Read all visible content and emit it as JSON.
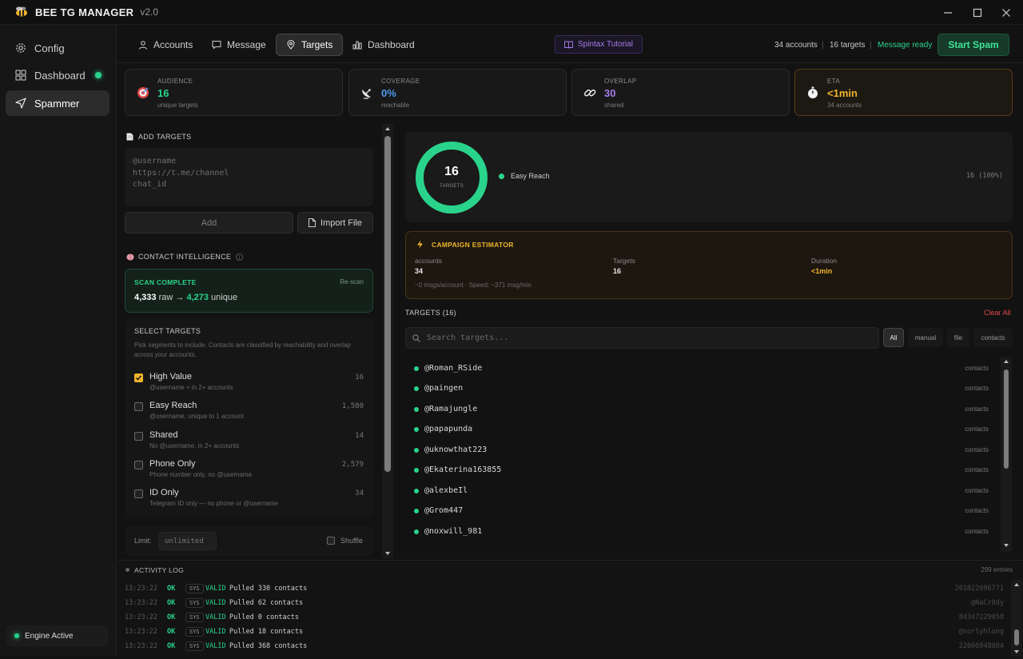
{
  "app": {
    "title": "BEE TG MANAGER",
    "version": "v2.0"
  },
  "sidebar": {
    "items": [
      {
        "label": "Config",
        "icon": "gear-icon"
      },
      {
        "label": "Dashboard",
        "icon": "grid-icon"
      },
      {
        "label": "Spammer",
        "icon": "send-icon"
      }
    ],
    "engine_status": "Engine Active"
  },
  "tabs": [
    {
      "label": "Accounts",
      "icon": "user-icon"
    },
    {
      "label": "Message",
      "icon": "message-icon"
    },
    {
      "label": "Targets",
      "icon": "target-pin-icon"
    },
    {
      "label": "Dashboard",
      "icon": "bar-chart-icon"
    }
  ],
  "topbar": {
    "spintax_label": "Spintax Tutorial",
    "accounts_count": "34 accounts",
    "targets_count": "16 targets",
    "message_status": "Message ready",
    "start_label": "Start Spam"
  },
  "stats": {
    "audience": {
      "label": "AUDIENCE",
      "value": "16",
      "sub": "unique targets",
      "color": "#2ad38b"
    },
    "coverage": {
      "label": "COVERAGE",
      "value": "0%",
      "sub": "reachable",
      "color": "#4c9bf0"
    },
    "overlap": {
      "label": "OVERLAP",
      "value": "30",
      "sub": "shared",
      "color": "#a67de8"
    },
    "eta": {
      "label": "ETA",
      "value": "<1min",
      "sub": "34 accounts",
      "color": "#f0b42c"
    }
  },
  "add_targets": {
    "title": "ADD TARGETS",
    "placeholder_lines": [
      "@username",
      "https://t.me/channel",
      "chat_id"
    ],
    "add_label": "Add",
    "import_label": "Import File"
  },
  "contact_intel": {
    "title": "CONTACT INTELLIGENCE",
    "scan_status": "SCAN COMPLETE",
    "rescan_label": "Re-scan",
    "raw": "4,333",
    "raw_word": "raw",
    "arrow": "→",
    "unique": "4,273",
    "unique_word": "unique"
  },
  "select_targets": {
    "title": "SELECT TARGETS",
    "description": "Pick segments to include. Contacts are classified by reachability and overlap across your accounts.",
    "segments": [
      {
        "name": "High Value",
        "desc": "@username + in 2+ accounts",
        "count": "16",
        "checked": true
      },
      {
        "name": "Easy Reach",
        "desc": "@username, unique to 1 account",
        "count": "1,580",
        "checked": false
      },
      {
        "name": "Shared",
        "desc": "No @username, in 2+ accounts",
        "count": "14",
        "checked": false
      },
      {
        "name": "Phone Only",
        "desc": "Phone number only, no @username",
        "count": "2,579",
        "checked": false
      },
      {
        "name": "ID Only",
        "desc": "Telegram ID only — no phone or @username",
        "count": "34",
        "checked": false
      }
    ],
    "limit_label": "Limit:",
    "limit_placeholder": "unlimited",
    "shuffle_label": "Shuffle"
  },
  "donut": {
    "total": "16",
    "total_label": "TARGETS",
    "legend_label": "Easy Reach",
    "legend_value": "16 (100%)",
    "fraction": 1.0,
    "color": "#2ad38b"
  },
  "estimator": {
    "title": "CAMPAIGN ESTIMATOR",
    "accounts_label": "accounts",
    "accounts_value": "34",
    "targets_label": "Targets",
    "targets_value": "16",
    "duration_label": "Duration",
    "duration_value": "<1min",
    "footer": "~0 msgs/account · Speed: ~371 msg/min"
  },
  "targets": {
    "title": "TARGETS (16)",
    "clear_label": "Clear All",
    "search_placeholder": "Search targets...",
    "filters": [
      "All",
      "manual",
      "file",
      "contacts"
    ],
    "rows": [
      {
        "name": "@Roman_RSide",
        "source": "contacts"
      },
      {
        "name": "@paingen",
        "source": "contacts"
      },
      {
        "name": "@Ramajungle",
        "source": "contacts"
      },
      {
        "name": "@papapunda",
        "source": "contacts"
      },
      {
        "name": "@uknowthat223",
        "source": "contacts"
      },
      {
        "name": "@Ekaterina163855",
        "source": "contacts"
      },
      {
        "name": "@alexbeIl",
        "source": "contacts"
      },
      {
        "name": "@Grom447",
        "source": "contacts"
      },
      {
        "name": "@noxwill_981",
        "source": "contacts"
      }
    ]
  },
  "activity_log": {
    "title": "ACTIVITY LOG",
    "entries_count": "299 entries",
    "rows": [
      {
        "time": "13:23:22",
        "status": "OK",
        "tag": "SYS",
        "kind": "VALID",
        "msg": "Pulled 330 contacts",
        "ref": "2018220967?1"
      },
      {
        "time": "13:23:22",
        "status": "OK",
        "tag": "SYS",
        "kind": "VALID",
        "msg": "Pulled 62 contacts",
        "ref": "@NaCr0dy"
      },
      {
        "time": "13:23:22",
        "status": "OK",
        "tag": "SYS",
        "kind": "VALID",
        "msg": "Pulled 0 contacts",
        "ref": "84347229058"
      },
      {
        "time": "13:23:22",
        "status": "OK",
        "tag": "SYS",
        "kind": "VALID",
        "msg": "Pulled 18 contacts",
        "ref": "@norlyhlong"
      },
      {
        "time": "13:23:22",
        "status": "OK",
        "tag": "SYS",
        "kind": "VALID",
        "msg": "Pulled 368 contacts",
        "ref": "22666948804"
      }
    ]
  }
}
